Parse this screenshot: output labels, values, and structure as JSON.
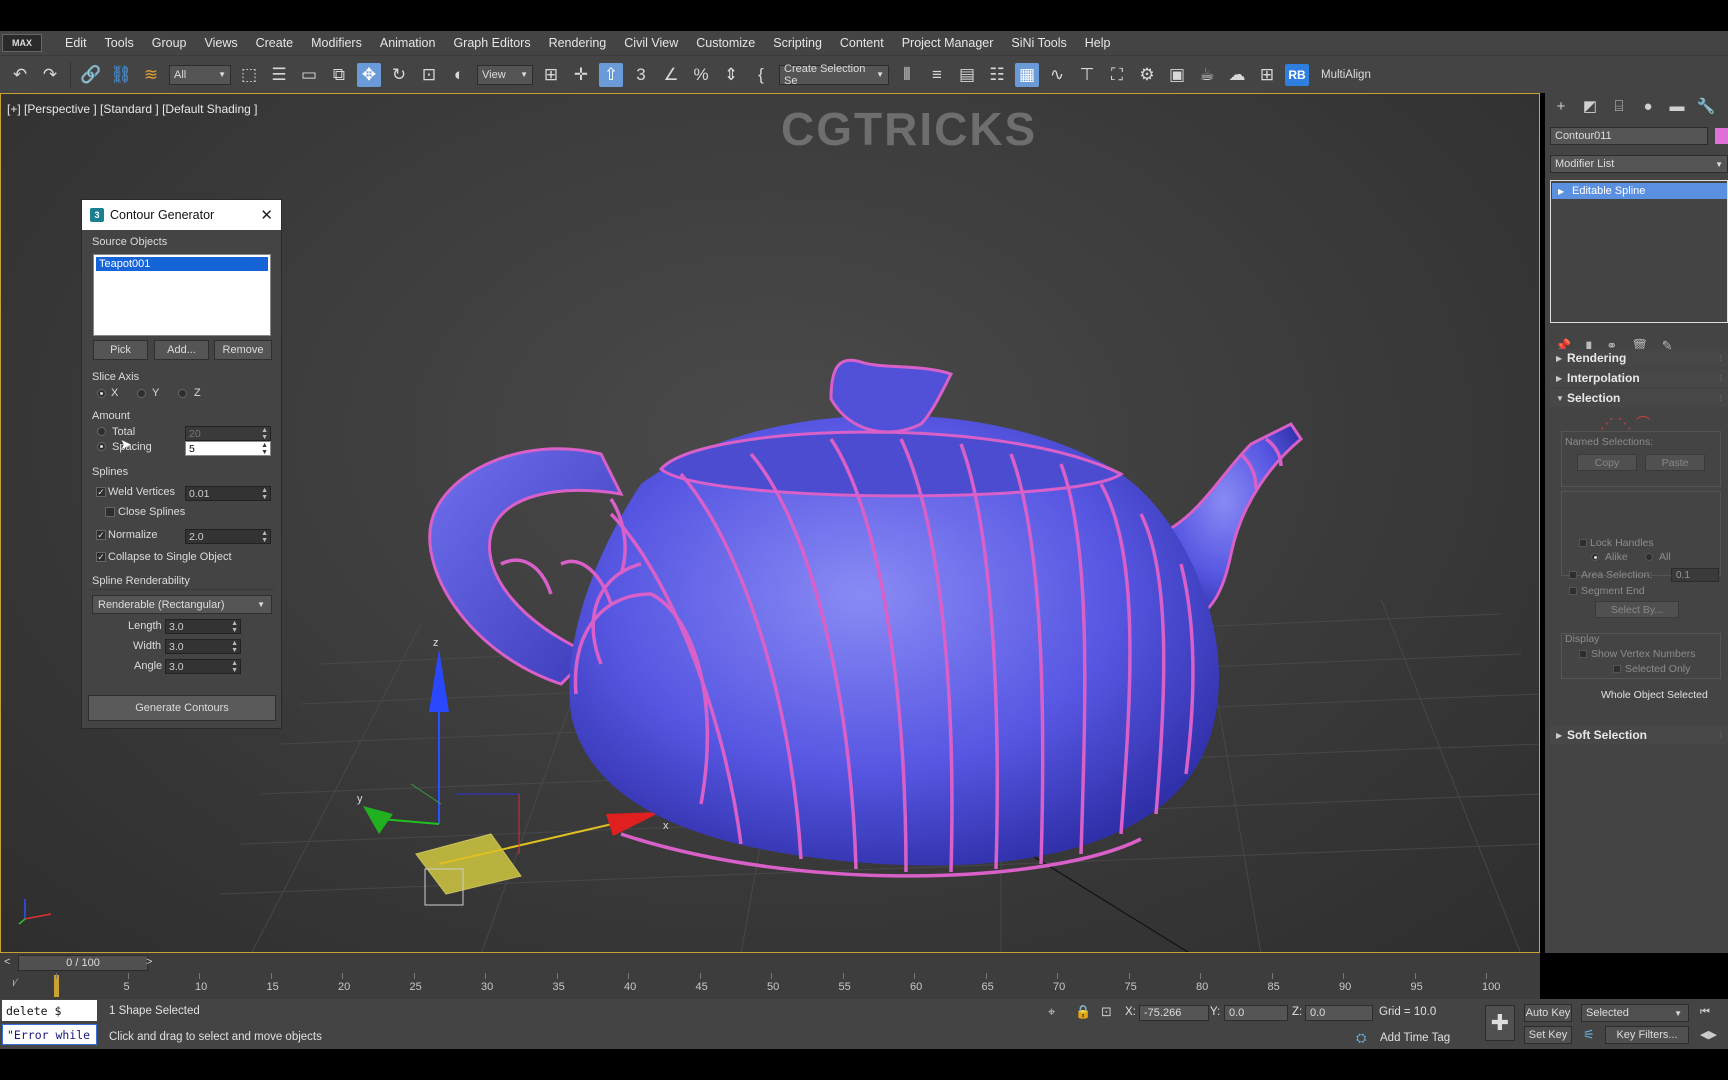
{
  "menu": {
    "logo": "MAX",
    "items": [
      "Edit",
      "Tools",
      "Group",
      "Views",
      "Create",
      "Modifiers",
      "Animation",
      "Graph Editors",
      "Rendering",
      "Civil View",
      "Customize",
      "Scripting",
      "Content",
      "Project Manager",
      "SiNi Tools",
      "Help"
    ]
  },
  "toolbar": {
    "filter_dropdown": "All",
    "refcoord_dropdown": "View",
    "selection_set_dropdown": "Create Selection Se",
    "rb_label": "RB",
    "multialign_label": "MultiAlign"
  },
  "viewport": {
    "label": "[+] [Perspective ] [Standard ] [Default Shading ]",
    "watermark": "CGTRICKS",
    "axis_labels": {
      "x": "x",
      "y": "y",
      "z": "z"
    }
  },
  "dialog": {
    "title": "Contour Generator",
    "app_icon": "3",
    "source_objects_label": "Source Objects",
    "source_objects": [
      "Teapot001"
    ],
    "pick": "Pick",
    "add": "Add...",
    "remove": "Remove",
    "slice_axis_label": "Slice Axis",
    "axis_x": "X",
    "axis_y": "Y",
    "axis_z": "Z",
    "amount_label": "Amount",
    "total_label": "Total",
    "total_value": "20",
    "spacing_label": "Spacing",
    "spacing_value": "5",
    "splines_label": "Splines",
    "weld_vertices_label": "Weld Vertices",
    "weld_vertices_value": "0.01",
    "close_splines_label": "Close Splines",
    "normalize_label": "Normalize",
    "normalize_value": "2.0",
    "collapse_label": "Collapse to Single Object",
    "renderability_label": "Spline Renderability",
    "renderability_value": "Renderable (Rectangular)",
    "length_label": "Length",
    "length_value": "3.0",
    "width_label": "Width",
    "width_value": "3.0",
    "angle_label": "Angle",
    "angle_value": "3.0",
    "generate": "Generate Contours"
  },
  "command_panel": {
    "object_name": "Contour011",
    "object_color": "#e070d8",
    "modifier_list": "Modifier List",
    "stack": [
      "Editable Spline"
    ],
    "rollouts": {
      "rendering": "Rendering",
      "interpolation": "Interpolation",
      "selection": "Selection",
      "soft_selection": "Soft Selection"
    },
    "named_selections": "Named Selections:",
    "copy": "Copy",
    "paste": "Paste",
    "lock_handles": "Lock Handles",
    "alike": "Alike",
    "all": "All",
    "area_selection": "Area Selection:",
    "area_selection_value": "0.1",
    "segment_end": "Segment End",
    "select_by": "Select By...",
    "display": "Display",
    "show_vertex_numbers": "Show Vertex Numbers",
    "selected_only": "Selected Only",
    "whole_object_selected": "Whole Object Selected"
  },
  "timeline": {
    "frame_display": "0 / 100",
    "prev": "<",
    "next": ">",
    "ticks": [
      0,
      5,
      10,
      15,
      20,
      25,
      30,
      35,
      40,
      45,
      50,
      55,
      60,
      65,
      70,
      75,
      80,
      85,
      90,
      95,
      100
    ]
  },
  "status": {
    "maxscript_line1": "delete $",
    "maxscript_line2": "\"Error while",
    "selection_info": "1 Shape Selected",
    "prompt": "Click and drag to select and move objects",
    "x_label": "X:",
    "x_value": "-75.266",
    "y_label": "Y:",
    "y_value": "0.0",
    "z_label": "Z:",
    "z_value": "0.0",
    "grid": "Grid = 10.0",
    "add_time_tag": "Add Time Tag",
    "auto_key": "Auto Key",
    "selected_dropdown": "Selected",
    "set_key": "Set Key",
    "key_filters": "Key Filters..."
  },
  "colors": {
    "accent_blue": "#1565d8",
    "teapot": "#5a5ae0",
    "contour": "#d860c8",
    "viewport_border": "#c8a232"
  }
}
